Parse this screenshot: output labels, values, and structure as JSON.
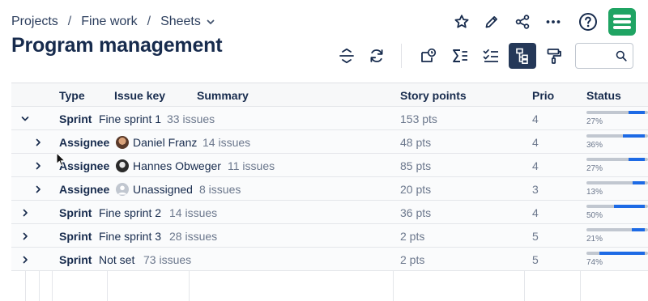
{
  "breadcrumb": {
    "items": [
      "Projects",
      "Fine work",
      "Sheets"
    ],
    "separator": "/"
  },
  "page_title": "Program management",
  "logo": {
    "color": "#1fa463"
  },
  "colors": {
    "accent": "#1d6ae5",
    "active_button": "#253858",
    "logo": "#1fa463"
  },
  "top_actions": {
    "icons": [
      "star-icon",
      "pencil-icon",
      "share-icon",
      "more-icon",
      "help-icon"
    ]
  },
  "toolbar": {
    "icons": [
      "collapse-rows-icon",
      "refresh-icon",
      "add-view-icon",
      "sum-icon",
      "checklist-icon",
      "hierarchy-icon",
      "format-paint-icon"
    ],
    "active": "hierarchy-icon"
  },
  "search": {
    "placeholder": "",
    "value": ""
  },
  "table": {
    "columns": [
      "Type",
      "Issue key",
      "Summary",
      "Story points",
      "Prio",
      "Status"
    ],
    "rows": [
      {
        "level": 0,
        "kind": "Sprint",
        "name": "Fine sprint 1",
        "count": "33 issues",
        "points": "153 pts",
        "prio": "4",
        "status_pct": "27%",
        "status_value": 0.27,
        "expanded": true,
        "avatar": ""
      },
      {
        "level": 1,
        "kind": "Assignee",
        "name": "Daniel Franz",
        "count": "14 issues",
        "points": "48 pts",
        "prio": "4",
        "status_pct": "36%",
        "status_value": 0.36,
        "expanded": false,
        "avatar": "photo"
      },
      {
        "level": 1,
        "kind": "Assignee",
        "name": "Hannes Obweger",
        "count": "11 issues",
        "points": "85 pts",
        "prio": "4",
        "status_pct": "27%",
        "status_value": 0.27,
        "expanded": false,
        "avatar": "photo-dark"
      },
      {
        "level": 1,
        "kind": "Assignee",
        "name": "Unassigned",
        "count": "8 issues",
        "points": "20 pts",
        "prio": "3",
        "status_pct": "13%",
        "status_value": 0.13,
        "expanded": false,
        "avatar": "placeholder"
      },
      {
        "level": 0,
        "kind": "Sprint",
        "name": "Fine sprint 2",
        "count": "14 issues",
        "points": "36 pts",
        "prio": "4",
        "status_pct": "50%",
        "status_value": 0.5,
        "expanded": false,
        "avatar": ""
      },
      {
        "level": 0,
        "kind": "Sprint",
        "name": "Fine sprint 3",
        "count": "28 issues",
        "points": "2 pts",
        "prio": "5",
        "status_pct": "21%",
        "status_value": 0.21,
        "expanded": false,
        "avatar": ""
      },
      {
        "level": 0,
        "kind": "Sprint",
        "name": "Not set",
        "count": "73 issues",
        "points": "2 pts",
        "prio": "5",
        "status_pct": "74%",
        "status_value": 0.74,
        "expanded": false,
        "avatar": ""
      }
    ]
  }
}
